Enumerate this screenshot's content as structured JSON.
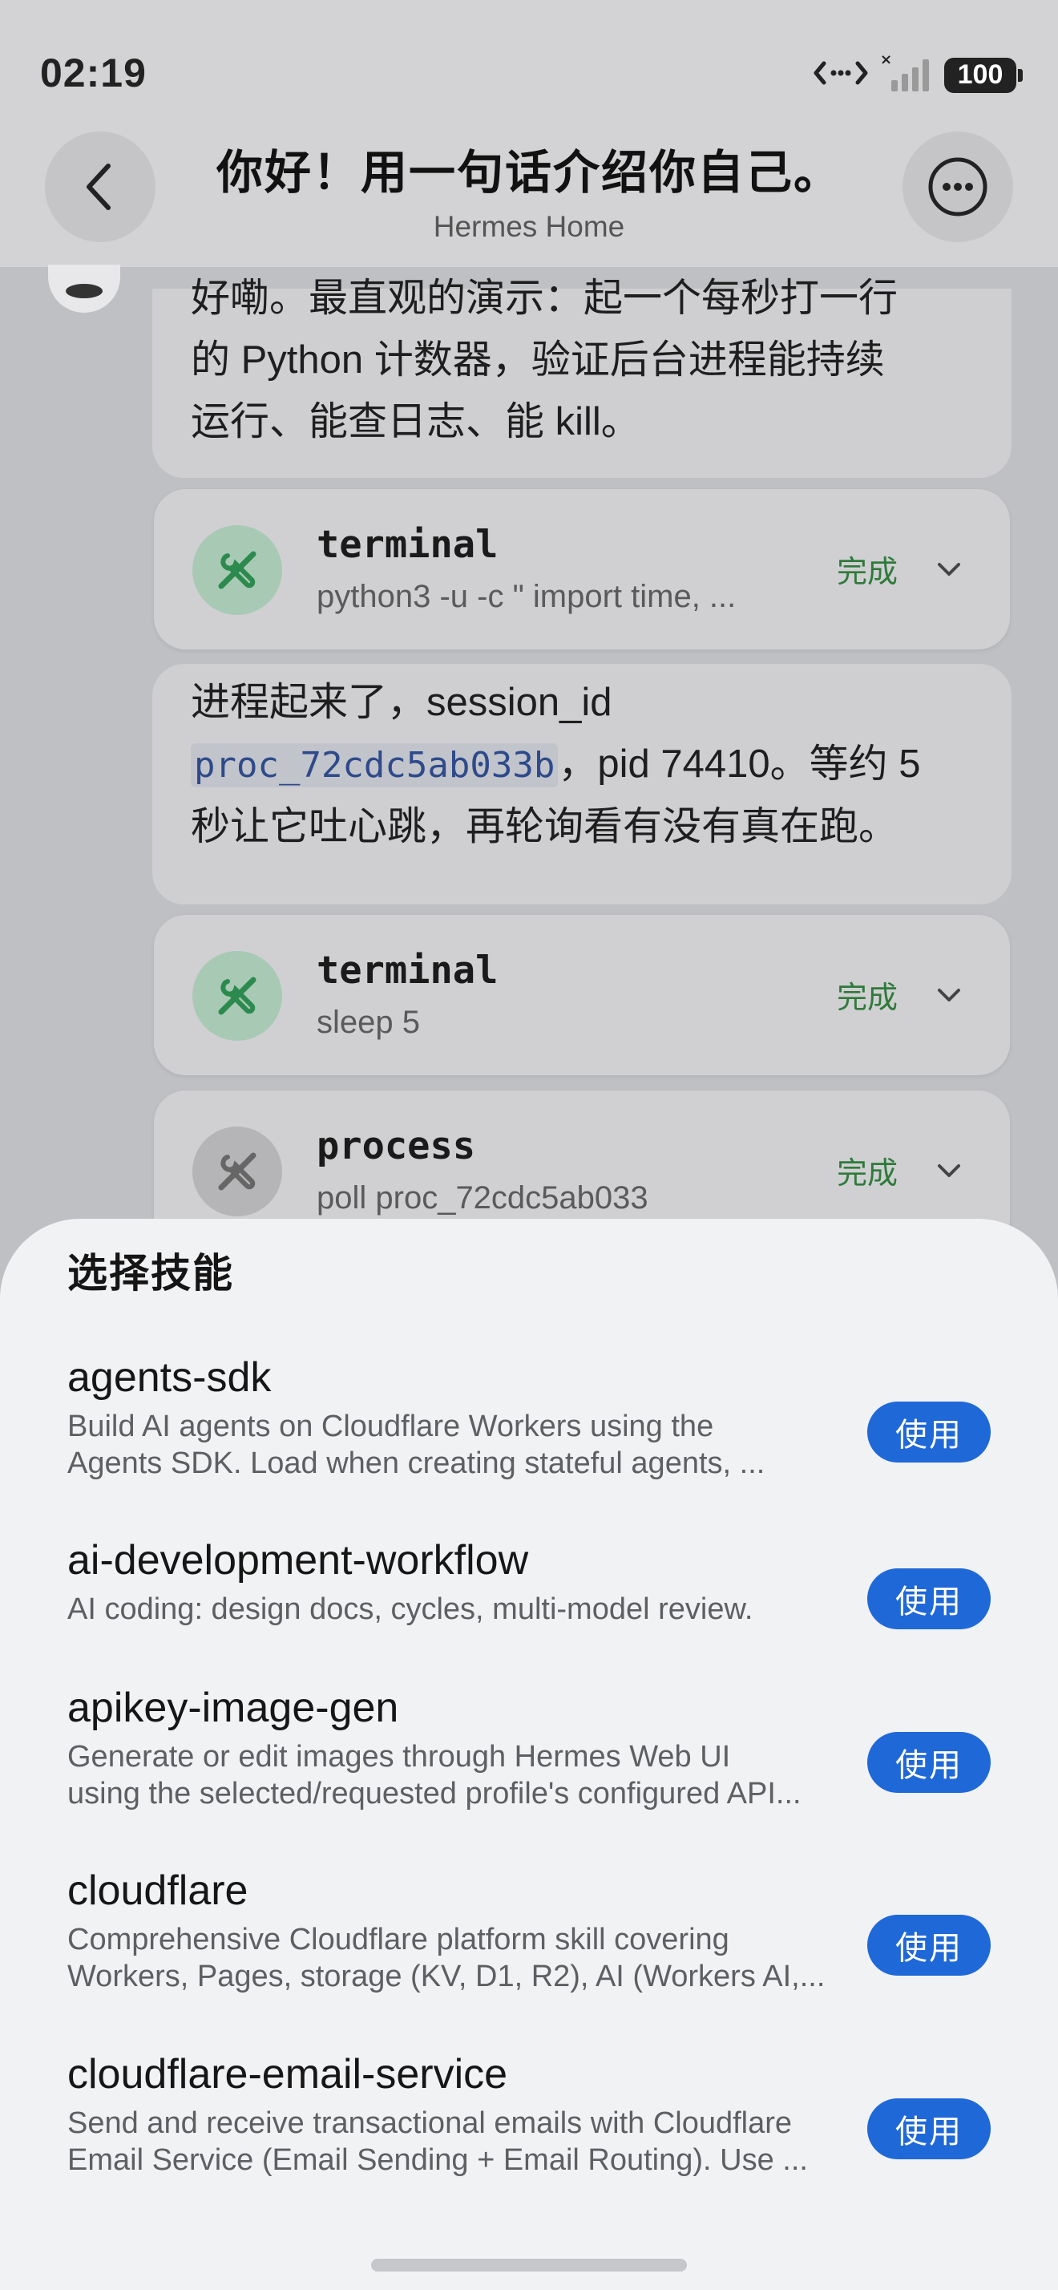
{
  "status_bar": {
    "time": "02:19",
    "battery": "100"
  },
  "header": {
    "title": "你好！用一句话介绍你自己。",
    "subtitle": "Hermes Home"
  },
  "messages": {
    "msg1": {
      "lines": [
        "好嘞。最直观的演示：起一个每秒打一行",
        "的 Python 计数器，验证后台进程能持续",
        "运行、能查日志、能 kill。"
      ]
    },
    "msg2": {
      "line1": "进程起来了，session_id",
      "code": "proc_72cdc5ab033b",
      "line2_rest": "，pid 74410。等约 5",
      "line3": "秒让它吐心跳，再轮询看有没有真在跑。"
    }
  },
  "tools": [
    {
      "name": "terminal",
      "command": "python3 -u -c \" import time, ...",
      "status": "完成",
      "icon": "wrench-screwdriver-icon"
    },
    {
      "name": "terminal",
      "command": "sleep 5",
      "status": "完成",
      "icon": "wrench-screwdriver-icon"
    },
    {
      "name": "process",
      "command": "poll proc_72cdc5ab033",
      "status": "完成",
      "icon": "wrench-screwdriver-icon"
    }
  ],
  "sheet": {
    "title": "选择技能",
    "use_label": "使用",
    "skills": [
      {
        "name": "agents-sdk",
        "desc": [
          "Build AI agents on Cloudflare Workers using the",
          "Agents SDK. Load when creating stateful agents, ..."
        ]
      },
      {
        "name": "ai-development-workflow",
        "desc": [
          "AI coding: design docs, cycles, multi-model review."
        ]
      },
      {
        "name": "apikey-image-gen",
        "desc": [
          "Generate or edit images through Hermes Web UI",
          "using the selected/requested profile's configured API..."
        ]
      },
      {
        "name": "cloudflare",
        "desc": [
          "Comprehensive Cloudflare platform skill covering",
          "Workers, Pages, storage (KV, D1, R2), AI (Workers AI,..."
        ]
      },
      {
        "name": "cloudflare-email-service",
        "desc": [
          "Send and receive transactional emails with Cloudflare",
          "Email Service (Email Sending + Email Routing). Use ..."
        ]
      }
    ]
  },
  "colors": {
    "accent": "#1f68d8",
    "done_green": "#2f7a3a"
  }
}
